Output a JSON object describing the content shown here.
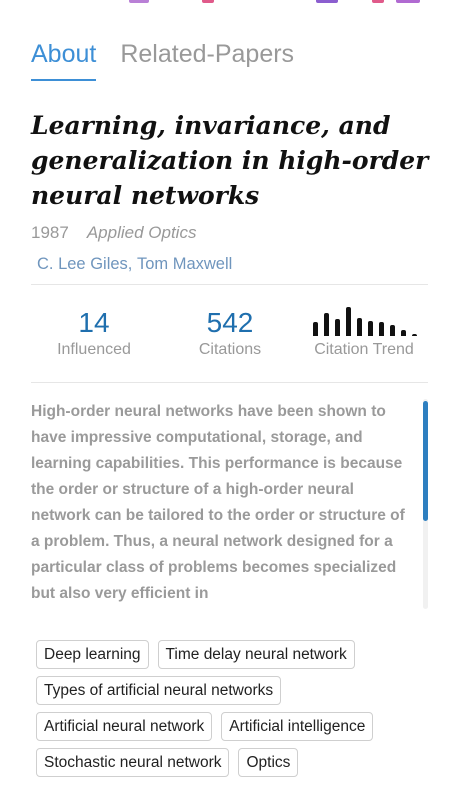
{
  "colors": {
    "accent": "#3d8fd6",
    "author_link": "#6f95bd",
    "stat_number": "#1f6fae",
    "top_strip": [
      "#b980d6",
      "#e05a8a",
      "#8b5ecf",
      "#e05a8a",
      "#b06ad1"
    ]
  },
  "tabs": [
    {
      "label": "About",
      "active": true
    },
    {
      "label": "Related-Papers",
      "active": false
    }
  ],
  "paper": {
    "title": "Learning, invariance, and generalization in high-order neural networks",
    "year": "1987",
    "journal": "Applied Optics",
    "authors": [
      "C. Lee Giles",
      "Tom Maxwell"
    ],
    "author_separator": ", "
  },
  "stats": {
    "influenced": {
      "value": "14",
      "label": "Influenced"
    },
    "citations": {
      "value": "542",
      "label": "Citations"
    },
    "trend": {
      "label": "Citation Trend",
      "bars": [
        0.45,
        0.75,
        0.55,
        0.95,
        0.6,
        0.5,
        0.45,
        0.35,
        0.2,
        0.05
      ]
    }
  },
  "abstract": "High-order neural networks have been shown to have impressive computational, storage, and learning capabilities. This performance is because the order or structure of a high-order neural network can be tailored to the order or structure of a problem. Thus, a neural network designed for a particular class of problems becomes specialized but also very efficient in",
  "tags": [
    "Deep learning",
    "Time delay neural network",
    "Types of artificial neural networks",
    "Artificial neural network",
    "Artificial intelligence",
    "Stochastic neural network",
    "Optics"
  ]
}
